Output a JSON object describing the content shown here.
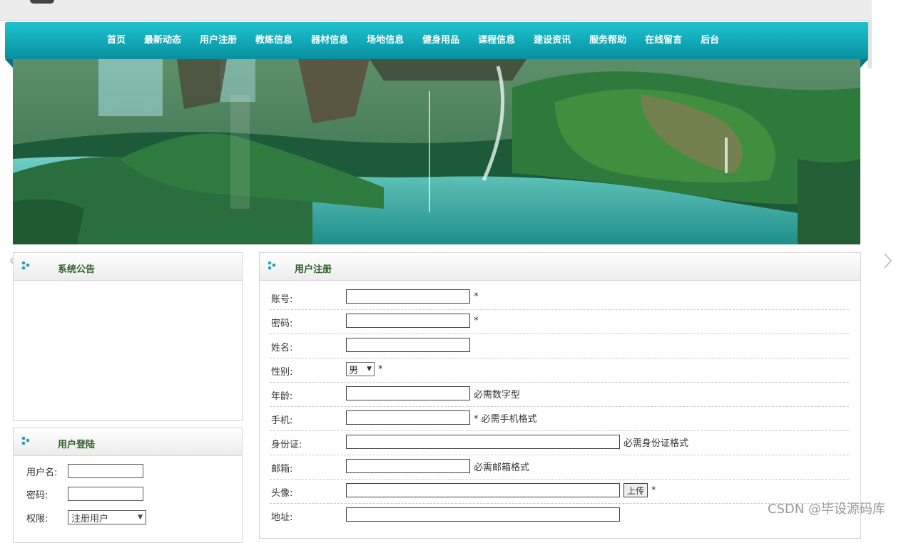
{
  "nav": {
    "items": [
      "首页",
      "最新动态",
      "用户注册",
      "教练信息",
      "器材信息",
      "场地信息",
      "健身用品",
      "课程信息",
      "建设资讯",
      "服务帮助",
      "在线留言",
      "后台"
    ]
  },
  "notice": {
    "title": "系统公告"
  },
  "login": {
    "title": "用户登陆",
    "username_label": "用户名:",
    "password_label": "密码:",
    "role_label": "权限:",
    "role_value": "注册用户"
  },
  "register": {
    "title": "用户注册",
    "account_label": "账号:",
    "password_label": "密码:",
    "name_label": "姓名:",
    "gender_label": "性别:",
    "gender_value": "男",
    "age_label": "年龄:",
    "age_hint": "必需数字型",
    "phone_label": "手机:",
    "phone_hint": "* 必需手机格式",
    "idcard_label": "身份证:",
    "idcard_hint": "必需身份证格式",
    "email_label": "邮箱:",
    "email_hint": "必需邮箱格式",
    "avatar_label": "头像:",
    "upload_label": "上传",
    "address_label": "地址:",
    "required_mark": "*"
  },
  "watermark": "CSDN @毕设源码库",
  "colors": {
    "nav": "#10a7b6",
    "panel_title": "#2f5f2a"
  }
}
